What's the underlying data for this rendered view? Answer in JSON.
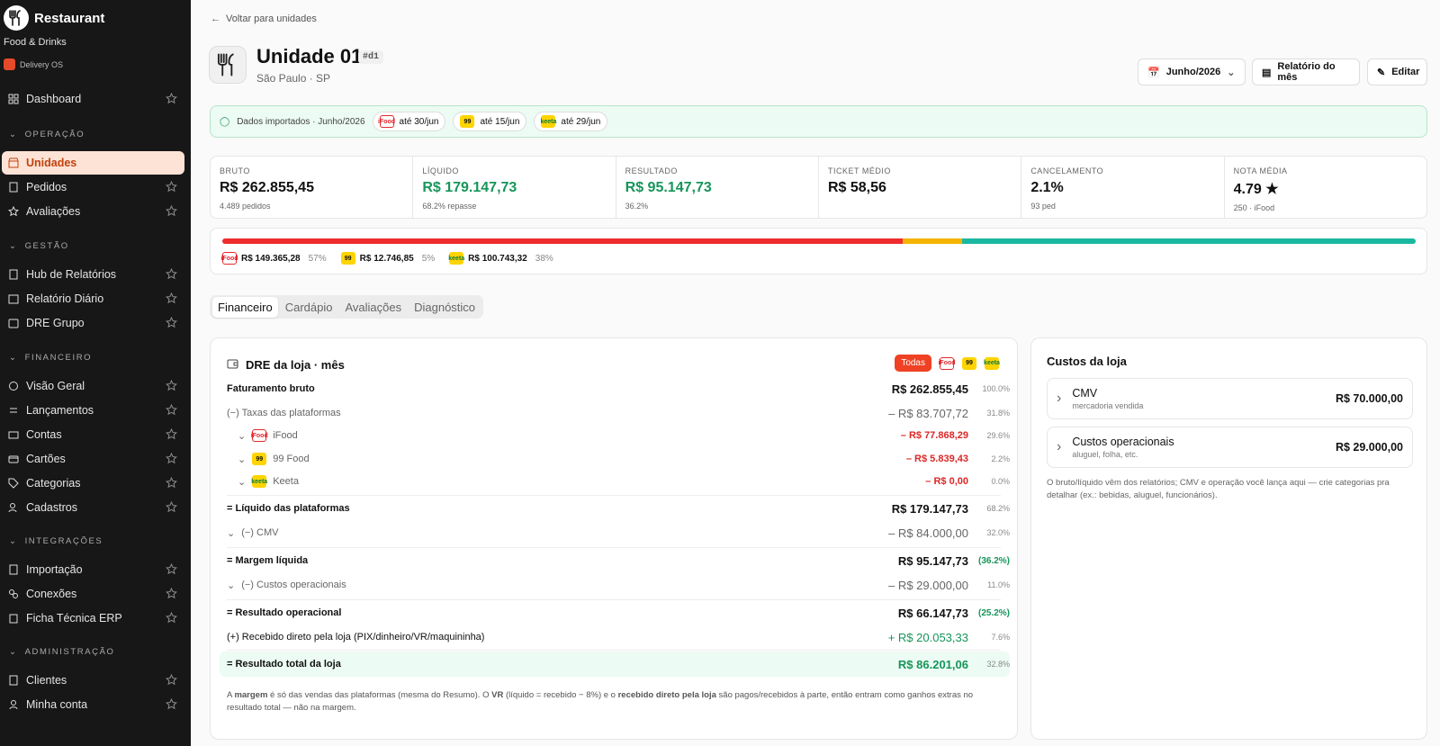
{
  "sidebar": {
    "brand": "Restaurant",
    "subtitle": "Food & Drinks",
    "app": "Delivery OS",
    "items": {
      "dashboard": "Dashboard",
      "unidades": "Unidades",
      "pedidos": "Pedidos",
      "avaliacoes": "Avaliações",
      "hub": "Hub de Relatórios",
      "diario": "Relatório Diário",
      "dre": "DRE Grupo",
      "visao": "Visão Geral",
      "lancamentos": "Lançamentos",
      "contas": "Contas",
      "cartoes": "Cartões",
      "categorias": "Categorias",
      "cadastros": "Cadastros",
      "importacao": "Importação",
      "conexoes": "Conexões",
      "ficha": "Ficha Técnica ERP",
      "clientes": "Clientes",
      "minha": "Minha conta"
    },
    "sections": {
      "operacao": "OPERAÇÃO",
      "gestao": "GESTÃO",
      "financeiro": "FINANCEIRO",
      "integracoes": "INTEGRAÇÕES",
      "admin": "ADMINISTRAÇÃO"
    }
  },
  "header": {
    "back": "Voltar para unidades",
    "title": "Unidade 01",
    "tag": "#d1",
    "location": "São Paulo · SP",
    "month": "Junho/2026",
    "report": "Relatório do mês",
    "edit": "Editar"
  },
  "import": {
    "text": "Dados importados · Junho/2026",
    "ifood": "até 30/jun",
    "nn": "até 15/jun",
    "keeta": "até 29/jun"
  },
  "kpis": [
    {
      "label": "BRUTO",
      "value": "R$ 262.855,45",
      "sub": "4.489 pedidos"
    },
    {
      "label": "LÍQUIDO",
      "value": "R$ 179.147,73",
      "sub": "68.2% repasse"
    },
    {
      "label": "RESULTADO",
      "value": "R$ 95.147,73",
      "sub": "36.2%"
    },
    {
      "label": "TICKET MÉDIO",
      "value": "R$ 58,56",
      "sub": ""
    },
    {
      "label": "CANCELAMENTO",
      "value": "2.1%",
      "sub": "93 ped"
    },
    {
      "label": "NOTA MÉDIA",
      "value": "4.79 ★",
      "sub": "250 · iFood"
    }
  ],
  "split": {
    "ifood": {
      "value": "R$ 149.365,28",
      "pct": "57%",
      "share": 57,
      "color": "#ef2b2d"
    },
    "nn": {
      "value": "R$ 12.746,85",
      "pct": "5%",
      "share": 5,
      "color": "#f5b400"
    },
    "keeta": {
      "value": "R$ 100.743,32",
      "pct": "38%",
      "share": 38,
      "color": "#1ab8a0"
    }
  },
  "tabs": [
    "Financeiro",
    "Cardápio",
    "Avaliações",
    "Diagnóstico"
  ],
  "dre": {
    "title": "DRE da loja · mês",
    "filter_all": "Todas",
    "rows": {
      "fat": {
        "label": "Faturamento bruto",
        "value": "R$ 262.855,45",
        "pct": "100.0%"
      },
      "tax": {
        "label": "(−) Taxas das plataformas",
        "value": "– R$ 83.707,72",
        "pct": "31.8%"
      },
      "ifood": {
        "label": "iFood",
        "value": "– R$ 77.868,29",
        "pct": "29.6%"
      },
      "nn": {
        "label": "99 Food",
        "value": "– R$ 5.839,43",
        "pct": "2.2%"
      },
      "keeta": {
        "label": "Keeta",
        "value": "– R$ 0,00",
        "pct": "0.0%"
      },
      "liq": {
        "label": "= Líquido das plataformas",
        "value": "R$ 179.147,73",
        "pct": "68.2%"
      },
      "cmv": {
        "label": "(−) CMV",
        "value": "– R$ 84.000,00",
        "pct": "32.0%"
      },
      "marg": {
        "label": "= Margem líquida",
        "value": "R$ 95.147,73",
        "pct": "(36.2%)"
      },
      "custos": {
        "label": "(−) Custos operacionais",
        "value": "– R$ 29.000,00",
        "pct": "11.0%"
      },
      "res": {
        "label": "= Resultado operacional",
        "value": "R$ 66.147,73",
        "pct": "(25.2%)"
      },
      "rec": {
        "label": "(+) Recebido direto pela loja (PIX/dinheiro/VR/maquininha)",
        "value": "+ R$ 20.053,33",
        "pct": "7.6%"
      },
      "tot": {
        "label": "= Resultado total da loja",
        "value": "R$ 86.201,06",
        "pct": "32.8%"
      }
    },
    "note": {
      "a": "A ",
      "b": "margem",
      "c": " é só das vendas das plataformas (mesma do Resumo). O ",
      "d": "VR",
      "e": " (líquido = recebido − 8%) e o ",
      "f": "recebido direto pela loja",
      "g": " são pagos/recebidos à parte, então entram como ganhos extras no resultado total — não na margem."
    }
  },
  "costs": {
    "title": "Custos da loja",
    "cmv": {
      "label": "CMV",
      "sub": "mercadoria vendida",
      "value": "R$ 70.000,00"
    },
    "op": {
      "label": "Custos operacionais",
      "sub": "aluguel, folha, etc.",
      "value": "R$ 29.000,00"
    },
    "note": "O bruto/líquido vêm dos relatórios; CMV e operação você lança aqui — crie categorias pra detalhar (ex.: bebidas, aluguel, funcionários)."
  },
  "colors": {
    "accent": "#ef4123",
    "green": "#16955a",
    "red": "#dc2626"
  },
  "platform_logos": {
    "ifood": "iFood",
    "nn": "99",
    "keeta": "keeta"
  }
}
